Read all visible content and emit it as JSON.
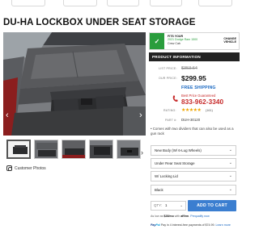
{
  "product": {
    "title": "DU-HA LOCKBOX UNDER SEAT STORAGE"
  },
  "gallery": {
    "customer_photos_label": "Customer Photos",
    "prev_arrow": "‹",
    "next_arrow": "›",
    "thumb_next": "›"
  },
  "fitment": {
    "check": "✓",
    "heading": "FITS YOUR",
    "vehicle": "2021 Dodge Ram 1500",
    "cab": "Crew Cab",
    "change_label_1": "CHANGE",
    "change_label_2": "VEHICLE"
  },
  "info": {
    "header": "PRODUCT INFORMATION",
    "list_price_label": "LIST PRICE:",
    "list_price": "$353.64",
    "our_price_label": "OUR PRICE:",
    "our_price": "$299.95",
    "free_shipping": "FREE SHIPPING",
    "best_price": "Best Price Guaranteed",
    "phone": "833-962-3340",
    "rating_label": "RATING:",
    "stars": "★★★★★",
    "review_count": "(161)",
    "part_label": "PART #:",
    "part_number": "DUH-30120",
    "bullet": "• Comes with two dividers that can also be used as a gun rack"
  },
  "options": {
    "select1": "New Body (W/ 6-Lug Wheels)",
    "select2": "Under Rear Seat Storage",
    "select3": "W/ Locking Lid",
    "select4": "Black",
    "chev": "⌄"
  },
  "cart": {
    "qty_label": "QTY:",
    "qty_value": "1",
    "add_button": "ADD TO CART"
  },
  "financing": {
    "affirm_prefix": "As low as",
    "affirm_amount": "$28/mo",
    "affirm_with": "with",
    "affirm_brand": "affirm",
    "affirm_link": "Prequalify now",
    "paypal_brand_1": "Pay",
    "paypal_brand_2": "Pal",
    "paypal_text": "Pay in 4 interest-free payments of $74.99.",
    "paypal_link": "Learn more"
  },
  "colors": {
    "accent_blue": "#3b7ed0",
    "price_red": "#c62828",
    "fit_green": "#2a9d3d",
    "star_gold": "#f0a500"
  }
}
